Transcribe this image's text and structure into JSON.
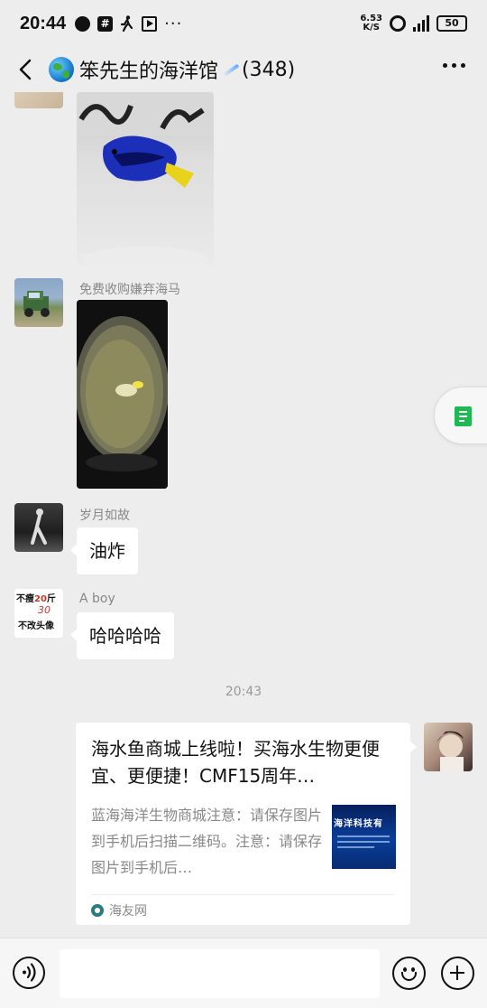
{
  "status_bar": {
    "time": "20:44",
    "network_speed_top": "6.53",
    "network_speed_bottom": "K/S",
    "battery": "50"
  },
  "header": {
    "title": "笨先生的海洋馆",
    "member_count": "(348)"
  },
  "messages": [
    {
      "sender": "",
      "type": "image"
    },
    {
      "sender": "免费收购嫌弃海马",
      "type": "image"
    },
    {
      "sender": "岁月如故",
      "type": "text",
      "text": "油炸"
    },
    {
      "sender": "A boy",
      "type": "text",
      "text": "哈哈哈哈",
      "avatar_text": [
        "不瘦",
        "20",
        "斤",
        "30",
        "不改头像"
      ]
    }
  ],
  "time_separator": "20:43",
  "link_card": {
    "title": "海水鱼商城上线啦！买海水生物更便宜、更便捷！CMF15周年…",
    "description": "蓝海海洋生物商城注意：请保存图片到手机后扫描二维码。注意：请保存图片到手机后…",
    "thumbnail_text": "海洋科技有",
    "source": "海友网"
  },
  "input_bar": {
    "placeholder": ""
  },
  "colors": {
    "background": "#ededed",
    "bubble": "#ffffff",
    "accent_green": "#1fb853"
  }
}
